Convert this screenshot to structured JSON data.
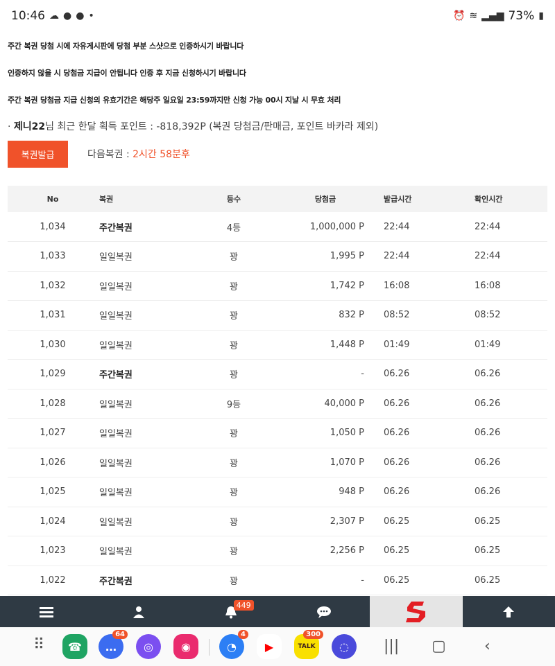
{
  "status": {
    "time": "10:46",
    "battery": "73%"
  },
  "notices": [
    "주간 복권 당첨 시에 자유게시판에 당첨 부분 스샷으로 인증하시기 바랍니다",
    "인증하지 않을 시 당첨금 지급이 안됩니다 인증 후 지금 신청하시기 바랍니다",
    "주간 복권 당첨금 지급 신청의 유효기간은 해당주 일요일 23:59까지만 신청 가능 00시 지날 시 무효 처리"
  ],
  "points": {
    "prefix": "· ",
    "username": "제니22",
    "text": "님 최근 한달 획득 포인트 : -818,392P (복권 당첨금/판매금, 포인트 바카라 제외)"
  },
  "issue_button": "복권발급",
  "next": {
    "label": "다음복권 : ",
    "time": "2시간 58분후"
  },
  "table": {
    "headers": [
      "No",
      "복권",
      "등수",
      "당첨금",
      "발급시간",
      "확인시간"
    ],
    "rows": [
      {
        "no": "1,034",
        "type": "주간복권",
        "weekly": true,
        "rank": "4등",
        "prize": "1,000,000 P",
        "issued": "22:44",
        "checked": "22:44"
      },
      {
        "no": "1,033",
        "type": "일일복권",
        "weekly": false,
        "rank": "꽝",
        "prize": "1,995 P",
        "issued": "22:44",
        "checked": "22:44"
      },
      {
        "no": "1,032",
        "type": "일일복권",
        "weekly": false,
        "rank": "꽝",
        "prize": "1,742 P",
        "issued": "16:08",
        "checked": "16:08"
      },
      {
        "no": "1,031",
        "type": "일일복권",
        "weekly": false,
        "rank": "꽝",
        "prize": "832 P",
        "issued": "08:52",
        "checked": "08:52"
      },
      {
        "no": "1,030",
        "type": "일일복권",
        "weekly": false,
        "rank": "꽝",
        "prize": "1,448 P",
        "issued": "01:49",
        "checked": "01:49"
      },
      {
        "no": "1,029",
        "type": "주간복권",
        "weekly": true,
        "rank": "꽝",
        "prize": "-",
        "issued": "06.26",
        "checked": "06.26"
      },
      {
        "no": "1,028",
        "type": "일일복권",
        "weekly": false,
        "rank": "9등",
        "prize": "40,000 P",
        "issued": "06.26",
        "checked": "06.26"
      },
      {
        "no": "1,027",
        "type": "일일복권",
        "weekly": false,
        "rank": "꽝",
        "prize": "1,050 P",
        "issued": "06.26",
        "checked": "06.26"
      },
      {
        "no": "1,026",
        "type": "일일복권",
        "weekly": false,
        "rank": "꽝",
        "prize": "1,070 P",
        "issued": "06.26",
        "checked": "06.26"
      },
      {
        "no": "1,025",
        "type": "일일복권",
        "weekly": false,
        "rank": "꽝",
        "prize": "948 P",
        "issued": "06.26",
        "checked": "06.26"
      },
      {
        "no": "1,024",
        "type": "일일복권",
        "weekly": false,
        "rank": "꽝",
        "prize": "2,307 P",
        "issued": "06.25",
        "checked": "06.25"
      },
      {
        "no": "1,023",
        "type": "일일복권",
        "weekly": false,
        "rank": "꽝",
        "prize": "2,256 P",
        "issued": "06.25",
        "checked": "06.25"
      },
      {
        "no": "1,022",
        "type": "주간복권",
        "weekly": true,
        "rank": "꽝",
        "prize": "-",
        "issued": "06.25",
        "checked": "06.25"
      }
    ]
  },
  "bottom_nav": {
    "notification_badge": "449",
    "icons": [
      "menu-icon",
      "user-icon",
      "bell-icon",
      "chat-icon",
      "site-logo",
      "arrow-up-icon"
    ]
  },
  "dock": {
    "messages_badge": "64",
    "app4_badge": "4",
    "talk_badge": "300",
    "talk_label": "TALK"
  },
  "colors": {
    "accent": "#f0522a",
    "nav_bg": "#2f3a44"
  }
}
